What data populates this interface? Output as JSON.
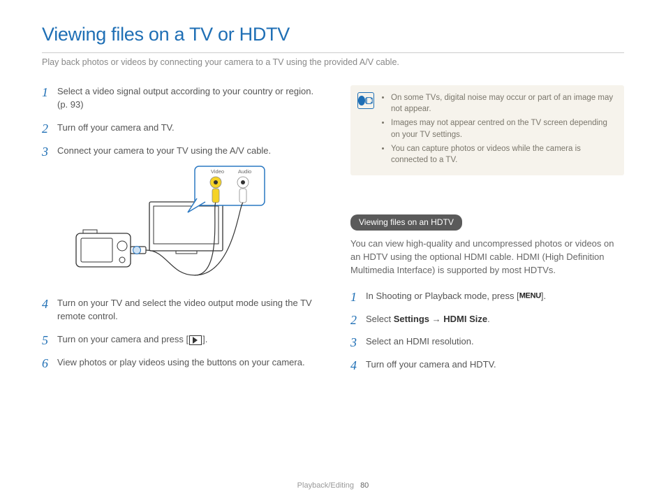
{
  "title": "Viewing files on a TV or HDTV",
  "subtitle": "Play back photos or videos by connecting your camera to a TV using the provided A/V cable.",
  "left_steps": [
    "Select a video signal output according to your country or region. (p. 93)",
    "Turn off your camera and TV.",
    "Connect your camera to your TV using the A/V cable."
  ],
  "left_steps_after": [
    "Turn on your TV and select the video output mode using the TV remote control.",
    "Turn on your camera and press [",
    "View photos or play videos using the buttons on your camera."
  ],
  "left_step5_suffix": "].",
  "diagram": {
    "label_video": "Video",
    "label_audio": "Audio"
  },
  "tips": [
    "On some TVs, digital noise may occur or part of an image may not appear.",
    "Images may not appear centred on the TV screen depending on your TV settings.",
    "You can capture photos or videos while the camera is connected to a TV."
  ],
  "hdtv": {
    "heading": "Viewing files on an HDTV",
    "intro": "You can view high-quality and uncompressed photos or videos on an HDTV using the optional HDMI cable. HDMI (High Definition Multimedia Interface) is supported by most HDTVs.",
    "steps": {
      "s1_pre": "In Shooting or Playback mode, press [",
      "s1_menu": "MENU",
      "s1_suf": "].",
      "s2_pre": "Select ",
      "s2_b1": "Settings",
      "s2_arrow": " → ",
      "s2_b2": "HDMI Size",
      "s2_suf": ".",
      "s3": "Select an HDMI resolution.",
      "s4": "Turn off your camera and HDTV."
    }
  },
  "footer": {
    "section": "Playback/Editing",
    "page": "80"
  }
}
